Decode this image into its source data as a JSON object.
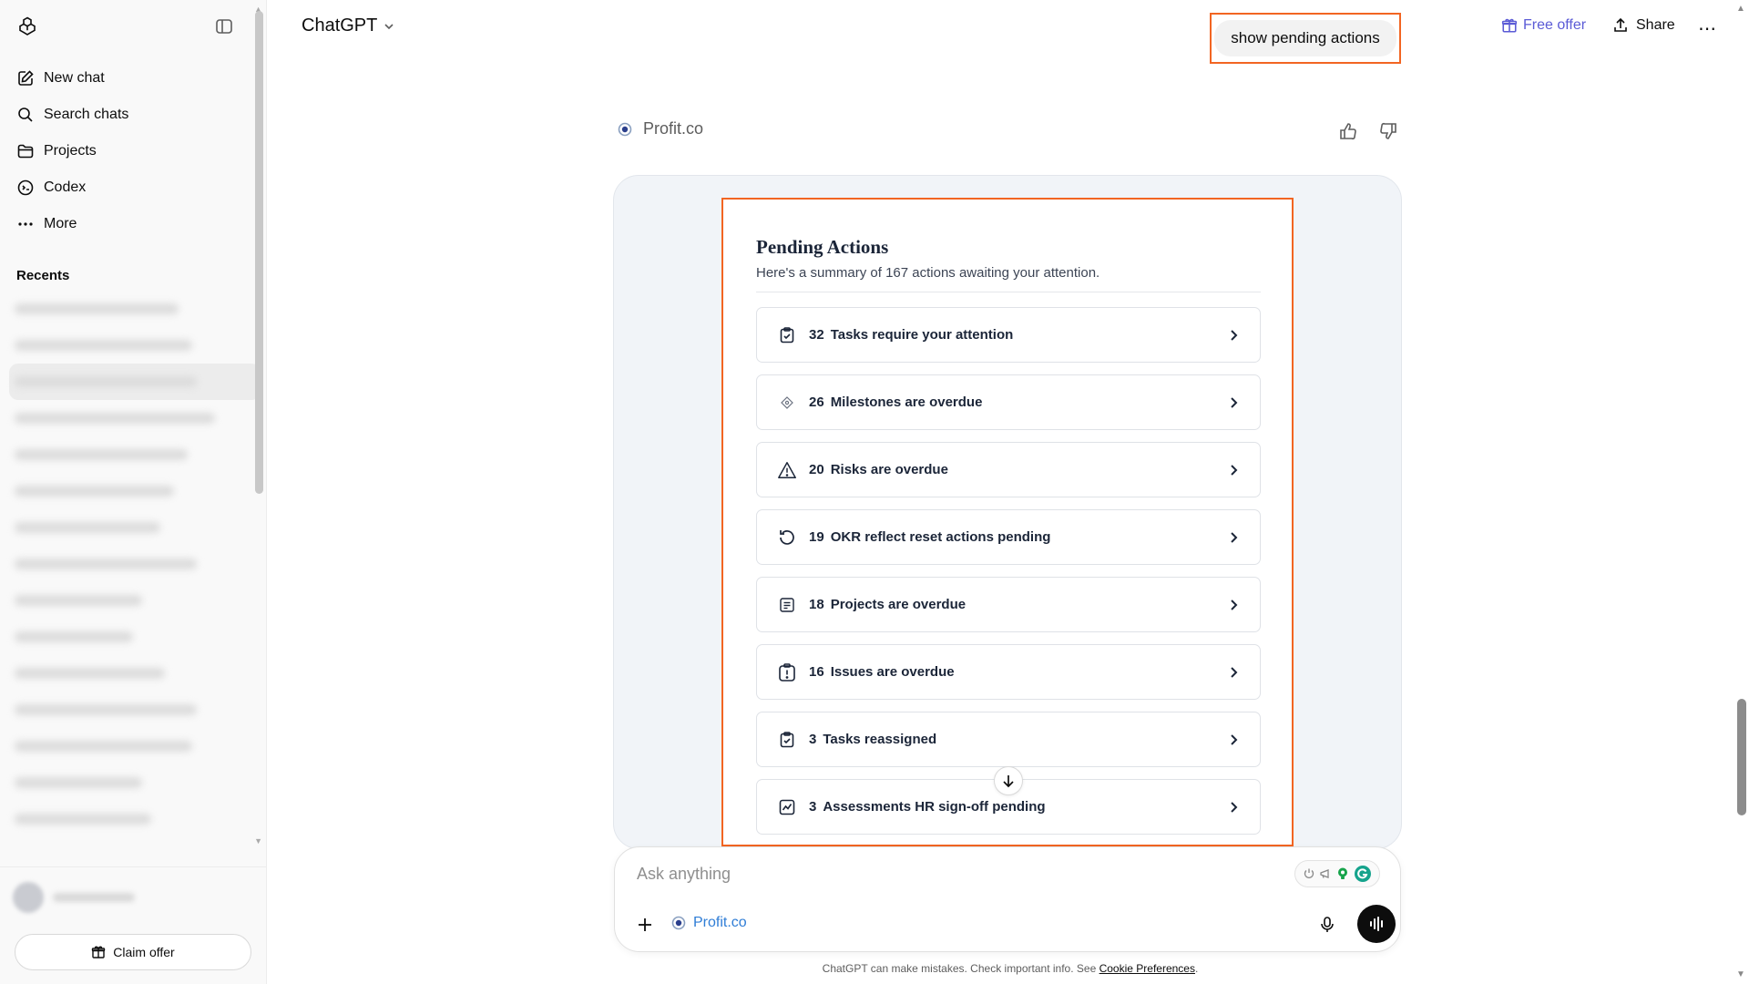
{
  "sidebar": {
    "nav": [
      {
        "label": "New chat",
        "icon": "edit-icon"
      },
      {
        "label": "Search chats",
        "icon": "search-icon"
      },
      {
        "label": "Projects",
        "icon": "folder-icon"
      },
      {
        "label": "Codex",
        "icon": "codex-icon"
      },
      {
        "label": "More",
        "icon": "dots-icon"
      }
    ],
    "recents_title": "Recents",
    "claim_offer": "Claim offer"
  },
  "header": {
    "model_name": "ChatGPT",
    "user_prompt": "show pending actions",
    "free_offer": "Free offer",
    "share": "Share"
  },
  "message": {
    "app_name": "Profit.co"
  },
  "widget": {
    "title": "Pending Actions",
    "subtitle": "Here's a summary of 167 actions awaiting your attention.",
    "actions": [
      {
        "count": "32",
        "label": "Tasks require your attention",
        "icon": "task-icon"
      },
      {
        "count": "26",
        "label": "Milestones are overdue",
        "icon": "milestone-icon"
      },
      {
        "count": "20",
        "label": "Risks are overdue",
        "icon": "warning-icon"
      },
      {
        "count": "19",
        "label": "OKR reflect reset actions pending",
        "icon": "reset-icon"
      },
      {
        "count": "18",
        "label": "Projects are overdue",
        "icon": "project-icon"
      },
      {
        "count": "16",
        "label": "Issues are overdue",
        "icon": "issue-icon"
      },
      {
        "count": "3",
        "label": "Tasks reassigned",
        "icon": "task-icon"
      },
      {
        "count": "3",
        "label": "Assessments HR sign-off pending",
        "icon": "assessment-icon"
      }
    ]
  },
  "composer": {
    "placeholder": "Ask anything",
    "tool_label": "Profit.co"
  },
  "footer": {
    "disclaimer": "ChatGPT can make mistakes. Check important info. See ",
    "link": "Cookie Preferences",
    "period": "."
  },
  "colors": {
    "highlight": "#f26522",
    "accent": "#5b5bd6",
    "link": "#2f7dd6"
  }
}
